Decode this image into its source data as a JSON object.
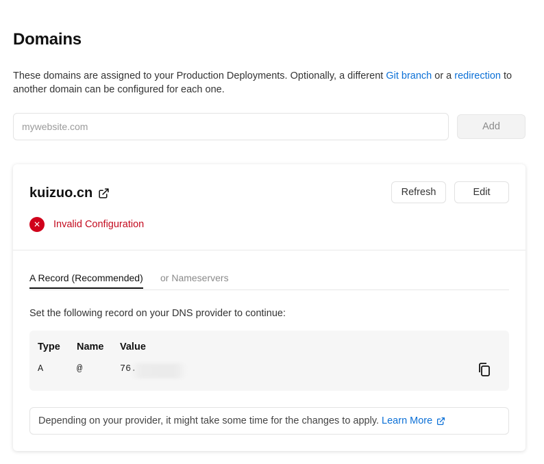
{
  "header": {
    "title": "Domains",
    "description_before_link1": "These domains are assigned to your Production Deployments. Optionally, a different ",
    "link1_label": "Git branch",
    "description_between_links": " or a ",
    "link2_label": "redirection",
    "description_after_link2": " to another domain can be configured for each one."
  },
  "add_domain": {
    "placeholder": "mywebsite.com",
    "value": "",
    "add_label": "Add"
  },
  "domain_card": {
    "domain": "kuizuo.cn",
    "refresh_label": "Refresh",
    "edit_label": "Edit",
    "status_symbol": "✕",
    "status_text": "Invalid Configuration",
    "tabs": [
      {
        "label": "A Record (Recommended)",
        "active": true
      },
      {
        "label": "or Nameservers",
        "active": false
      }
    ],
    "instruction": "Set the following record on your DNS provider to continue:",
    "record": {
      "headers": [
        "Type",
        "Name",
        "Value"
      ],
      "type": "A",
      "name": "@",
      "value": "76."
    },
    "note_text": "Depending on your provider, it might take some time for the changes to apply.",
    "learn_more_label": "Learn More"
  },
  "colors": {
    "link": "#0a6fd6",
    "error": "#d0021b",
    "error_text": "#c30a1e"
  }
}
